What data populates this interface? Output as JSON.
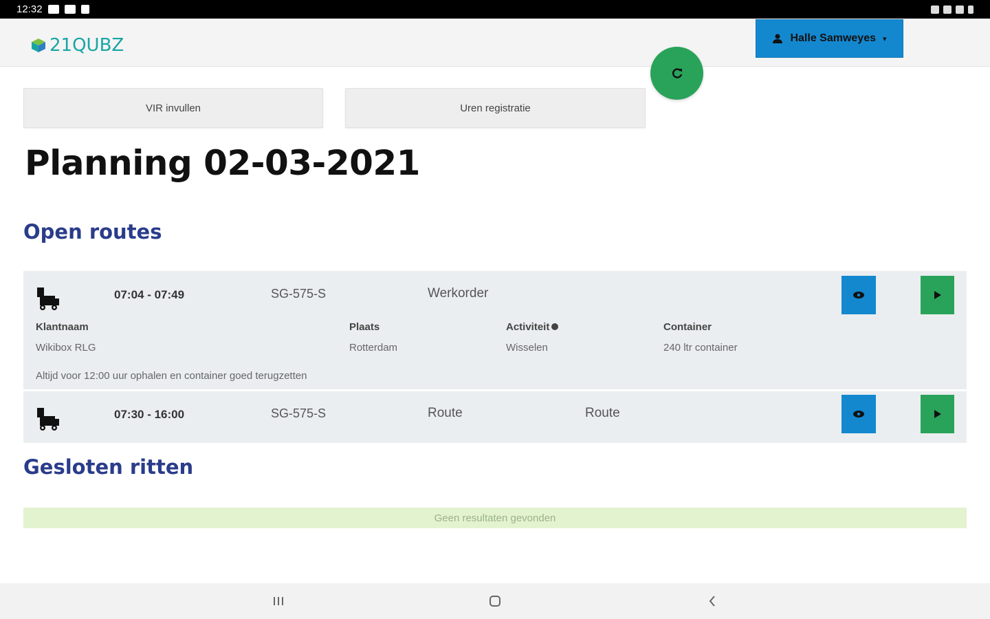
{
  "status_bar": {
    "time": "12:32"
  },
  "header": {
    "logo_text": "21QUBZ",
    "user_name": "Halle Samweyes",
    "user_caret": "▾"
  },
  "actions": {
    "vir_label": "VIR invullen",
    "uren_label": "Uren registratie"
  },
  "page_title": "Planning 02-03-2021",
  "open_routes": {
    "title": "Open routes",
    "items": [
      {
        "time": "07:04 - 07:49",
        "plate": "SG-575-S",
        "type": "Werkorder",
        "labels": {
          "klant": "Klantnaam",
          "plaats": "Plaats",
          "activiteit": "Activiteit",
          "container": "Container"
        },
        "values": {
          "klant": "Wikibox RLG",
          "plaats": "Rotterdam",
          "activiteit": "Wisselen",
          "container": "240 ltr container"
        },
        "note": "Altijd voor 12:00 uur ophalen en container goed terugzetten"
      },
      {
        "time": "07:30 - 16:00",
        "plate": "SG-575-S",
        "type": "Route",
        "type2": "Route"
      }
    ]
  },
  "closed_routes": {
    "title": "Gesloten ritten",
    "empty_message": "Geen resultaten gevonden"
  },
  "colors": {
    "primary_blue": "#1488cf",
    "success_green": "#2aa35a",
    "section_title": "#2a3c8a",
    "empty_bg": "#e3f3cf"
  }
}
